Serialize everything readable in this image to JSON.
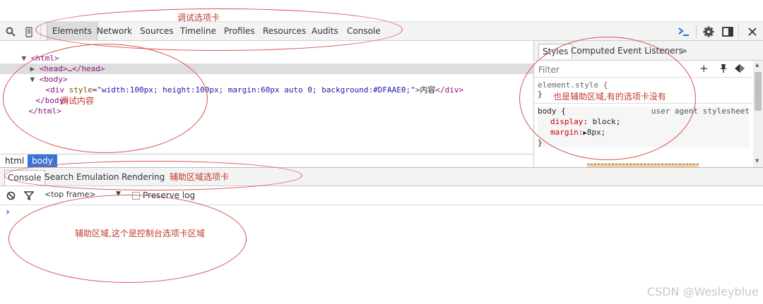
{
  "toolbar": {
    "tabs": [
      "Elements",
      "Network",
      "Sources",
      "Timeline",
      "Profiles",
      "Resources",
      "Audits",
      "Console"
    ],
    "active_tab": "Elements",
    "icons": [
      "search-icon",
      "device-mode-icon",
      "console-drawer-icon",
      "gear-icon",
      "dock-side-icon",
      "close-icon"
    ]
  },
  "elements": {
    "html_open": "<html>",
    "head_line": "<head>…</head>",
    "body_open": "<body>",
    "div_open_tag": "<div",
    "div_attr_name": "style",
    "div_attr_value": "\"width:100px; height:100px; margin:60px auto 0; background:#DFAAE0;\"",
    "div_text": "内容",
    "div_close_tag": "</div>",
    "body_close": "</body>",
    "html_close": "</html>"
  },
  "breadcrumb": [
    "html",
    "body"
  ],
  "sidebar": {
    "tabs": [
      "Styles",
      "Computed",
      "Event Listeners"
    ],
    "more_symbol": "»",
    "filter_placeholder": "Filter",
    "element_style_selector": "element.style {",
    "element_style_close": "}",
    "body_selector": "body {",
    "body_source": "user agent stylesheet",
    "prop1_name": "display",
    "prop1_value": "block;",
    "prop2_name": "margin",
    "prop2_value": "8px;",
    "body_close": "}",
    "add_symbol": "+",
    "colon": ":"
  },
  "drawer": {
    "tabs": [
      "Console",
      "Search",
      "Emulation",
      "Rendering"
    ],
    "active_tab": "Console",
    "frame_select": "<top frame>",
    "preserve_log_label": "Preserve log",
    "prompt": "›"
  },
  "annotations": {
    "debug_tabs": "调试选项卡",
    "debug_content": "调试内容",
    "sidebar_note": "也是辅助区域,有的选项卡没有",
    "drawer_tabs_note": "辅助区域选项卡",
    "console_note": "辅助区域,这个是控制台选项卡区域"
  },
  "watermark": "CSDN @Wesleyblue",
  "colors": {
    "tag": "#881280",
    "attr_name": "#994500",
    "attr_value": "#1a1aa6",
    "css_prop": "#c80000",
    "breadcrumb_active": "#3b74d6",
    "annotation": "#c0392b"
  }
}
